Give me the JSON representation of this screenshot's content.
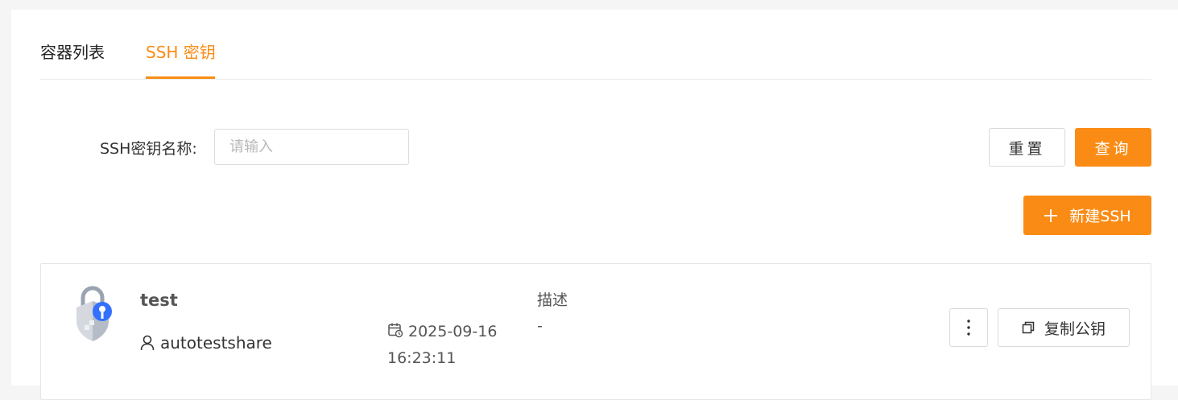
{
  "tabs": [
    {
      "label": "容器列表",
      "active": false
    },
    {
      "label": "SSH 密钥",
      "active": true
    }
  ],
  "search": {
    "label": "SSH密钥名称:",
    "placeholder": "请输入",
    "value": ""
  },
  "buttons": {
    "reset": "重置",
    "query": "查询",
    "new": "新建SSH",
    "copy": "复制公钥"
  },
  "keys": [
    {
      "name": "test",
      "owner": "autotestshare",
      "created_date": "2025-09-16",
      "created_time": "16:23:11",
      "description_label": "描述",
      "description": "-"
    }
  ],
  "icons": {
    "key_logo": "shield-key-icon",
    "owner": "user-icon",
    "created": "calendar-clock-icon",
    "more": "more-vertical-icon",
    "copy": "copy-icon",
    "add": "plus-icon"
  },
  "colors": {
    "accent": "#fa8c16",
    "key_blue": "#3370ff"
  }
}
